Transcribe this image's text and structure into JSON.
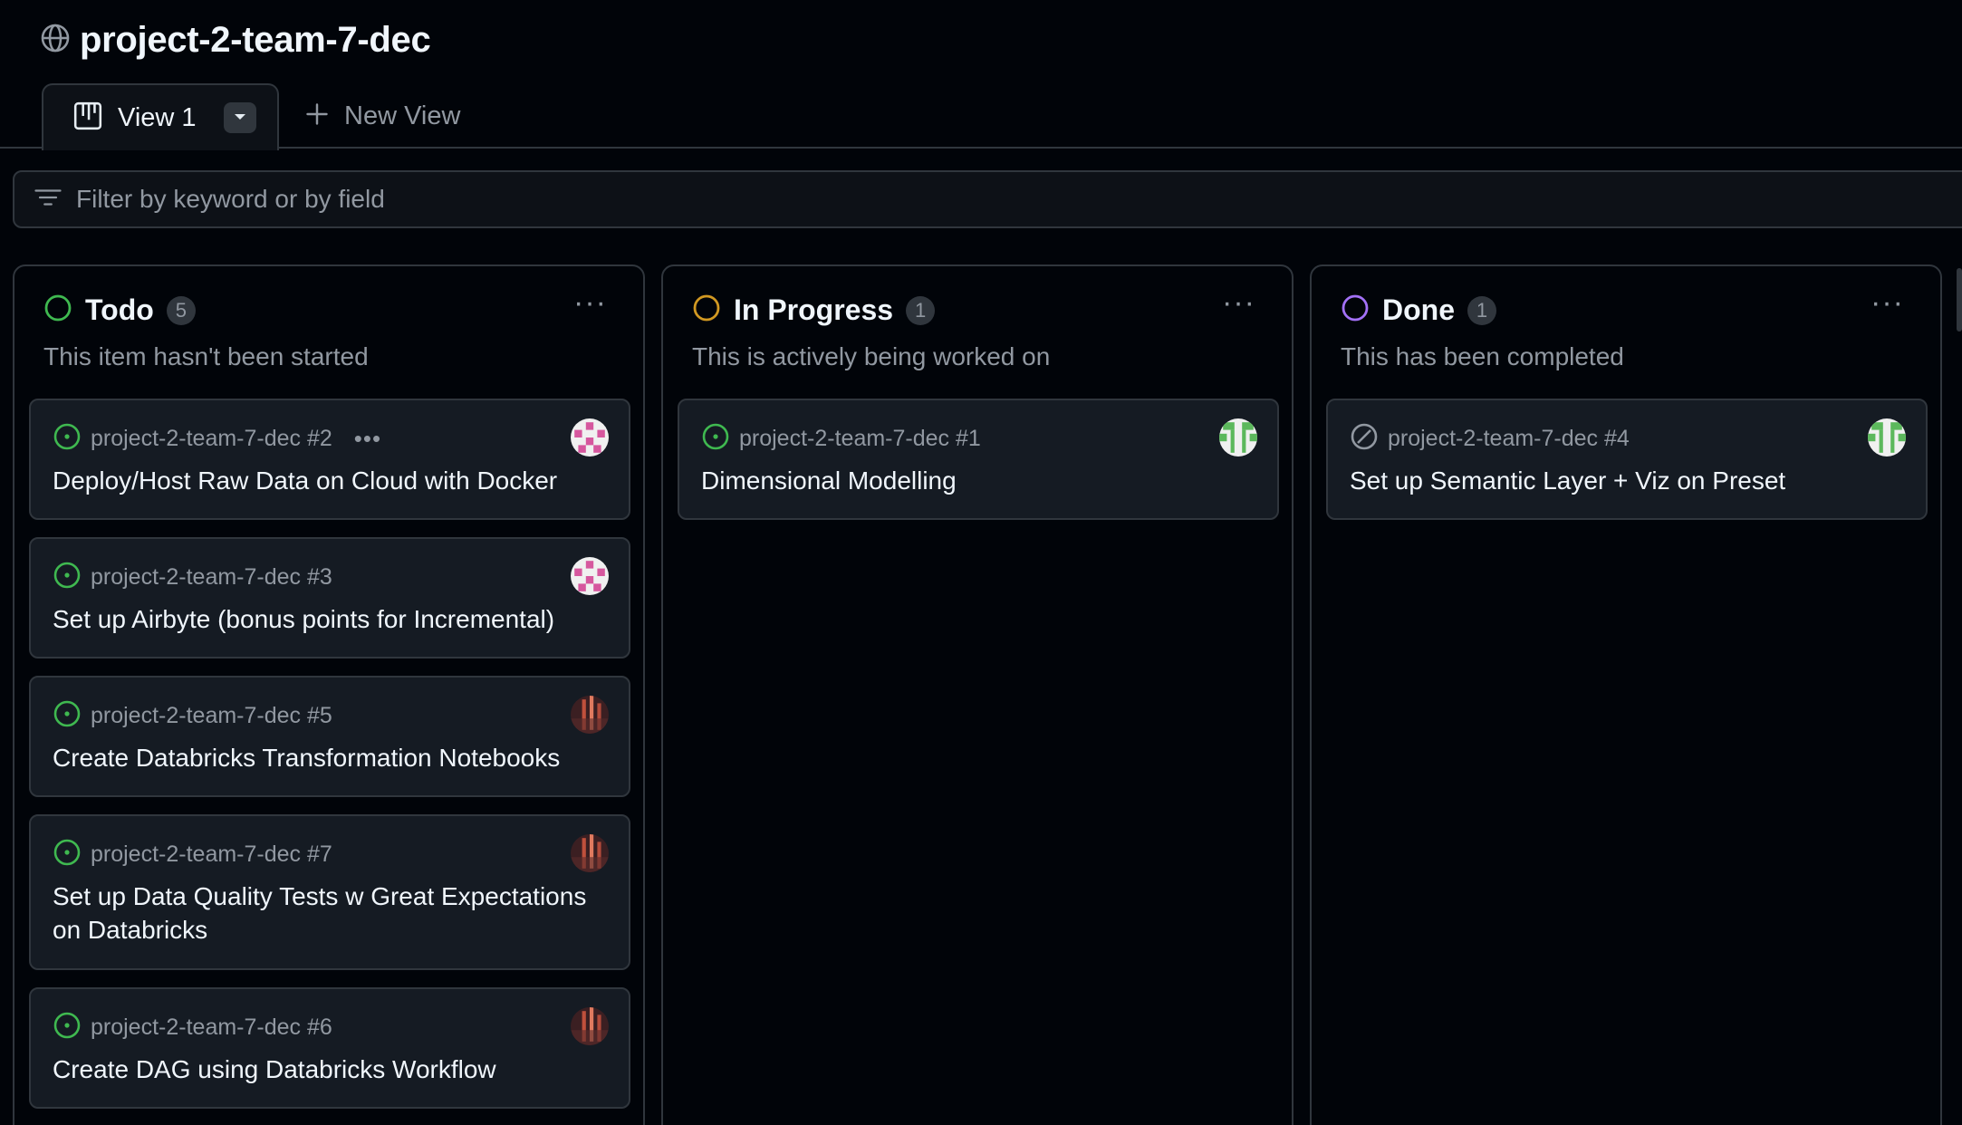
{
  "project": {
    "title": "project-2-team-7-dec"
  },
  "tabs": [
    {
      "label": "View 1"
    }
  ],
  "new_view": {
    "label": "New View"
  },
  "filter": {
    "placeholder": "Filter by keyword or by field"
  },
  "colors": {
    "todo": "#3fb950",
    "in_progress": "#d29922",
    "done": "#a371f7",
    "muted": "#9198a1"
  },
  "columns": [
    {
      "title": "Todo",
      "count": "5",
      "description": "This item hasn't been started",
      "cards": [
        {
          "ref": "project-2-team-7-dec #2",
          "title": "Deploy/Host Raw Data on Cloud with Docker",
          "status_icon": "open-issue-icon",
          "avatar": "pink-avatar"
        },
        {
          "ref": "project-2-team-7-dec #3",
          "title": "Set up Airbyte (bonus points for Incremental)",
          "status_icon": "open-issue-icon",
          "avatar": "pink-avatar"
        },
        {
          "ref": "project-2-team-7-dec #5",
          "title": "Create Databricks Transformation Notebooks",
          "status_icon": "open-issue-icon",
          "avatar": "photo-avatar"
        },
        {
          "ref": "project-2-team-7-dec #7",
          "title": "Set up Data Quality Tests w Great Expectations on Databricks",
          "status_icon": "open-issue-icon",
          "avatar": "photo-avatar"
        },
        {
          "ref": "project-2-team-7-dec #6",
          "title": "Create DAG using Databricks Workflow",
          "status_icon": "open-issue-icon",
          "avatar": "photo-avatar"
        }
      ]
    },
    {
      "title": "In Progress",
      "count": "1",
      "description": "This is actively being worked on",
      "cards": [
        {
          "ref": "project-2-team-7-dec #1",
          "title": "Dimensional Modelling",
          "status_icon": "open-issue-icon",
          "avatar": "green-avatar"
        }
      ]
    },
    {
      "title": "Done",
      "count": "1",
      "description": "This has been completed",
      "cards": [
        {
          "ref": "project-2-team-7-dec #4",
          "title": "Set up Semantic Layer + Viz on Preset",
          "status_icon": "closed-not-planned-icon",
          "avatar": "green-avatar"
        }
      ]
    }
  ]
}
